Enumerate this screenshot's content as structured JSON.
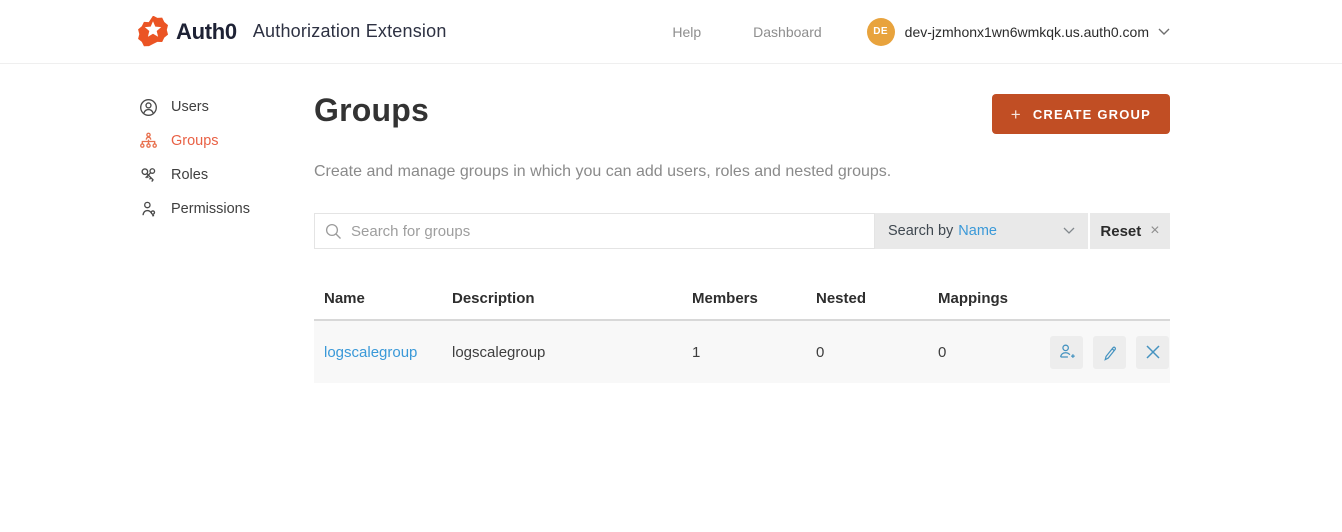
{
  "header": {
    "brand": "Auth0",
    "app_title": "Authorization Extension",
    "help_label": "Help",
    "dashboard_label": "Dashboard",
    "avatar_initials": "DE",
    "tenant_domain": "dev-jzmhonx1wn6wmkqk.us.auth0.com"
  },
  "sidebar": {
    "items": [
      {
        "label": "Users",
        "icon": "user-circle-icon",
        "active": false
      },
      {
        "label": "Groups",
        "icon": "org-chart-icon",
        "active": true
      },
      {
        "label": "Roles",
        "icon": "keys-icon",
        "active": false
      },
      {
        "label": "Permissions",
        "icon": "user-key-icon",
        "active": false
      }
    ]
  },
  "main": {
    "title": "Groups",
    "create_button_label": "CREATE GROUP",
    "description": "Create and manage groups in which you can add users, roles and nested groups."
  },
  "search": {
    "placeholder": "Search for groups",
    "by_label": "Search by",
    "by_value": "Name",
    "reset_label": "Reset"
  },
  "table": {
    "columns": [
      "Name",
      "Description",
      "Members",
      "Nested",
      "Mappings"
    ],
    "rows": [
      {
        "name": "logscalegroup",
        "description": "logscalegroup",
        "members": "1",
        "nested": "0",
        "mappings": "0"
      }
    ]
  },
  "icons": {
    "plus": "+",
    "close": "×"
  },
  "colors": {
    "brand_orange": "#EB5424",
    "button_orange": "#C14E24",
    "active_nav_orange": "#E96145",
    "link_blue": "#3A99D8",
    "action_icon_blue": "#4593C0",
    "avatar_gold": "#E8A33D"
  }
}
